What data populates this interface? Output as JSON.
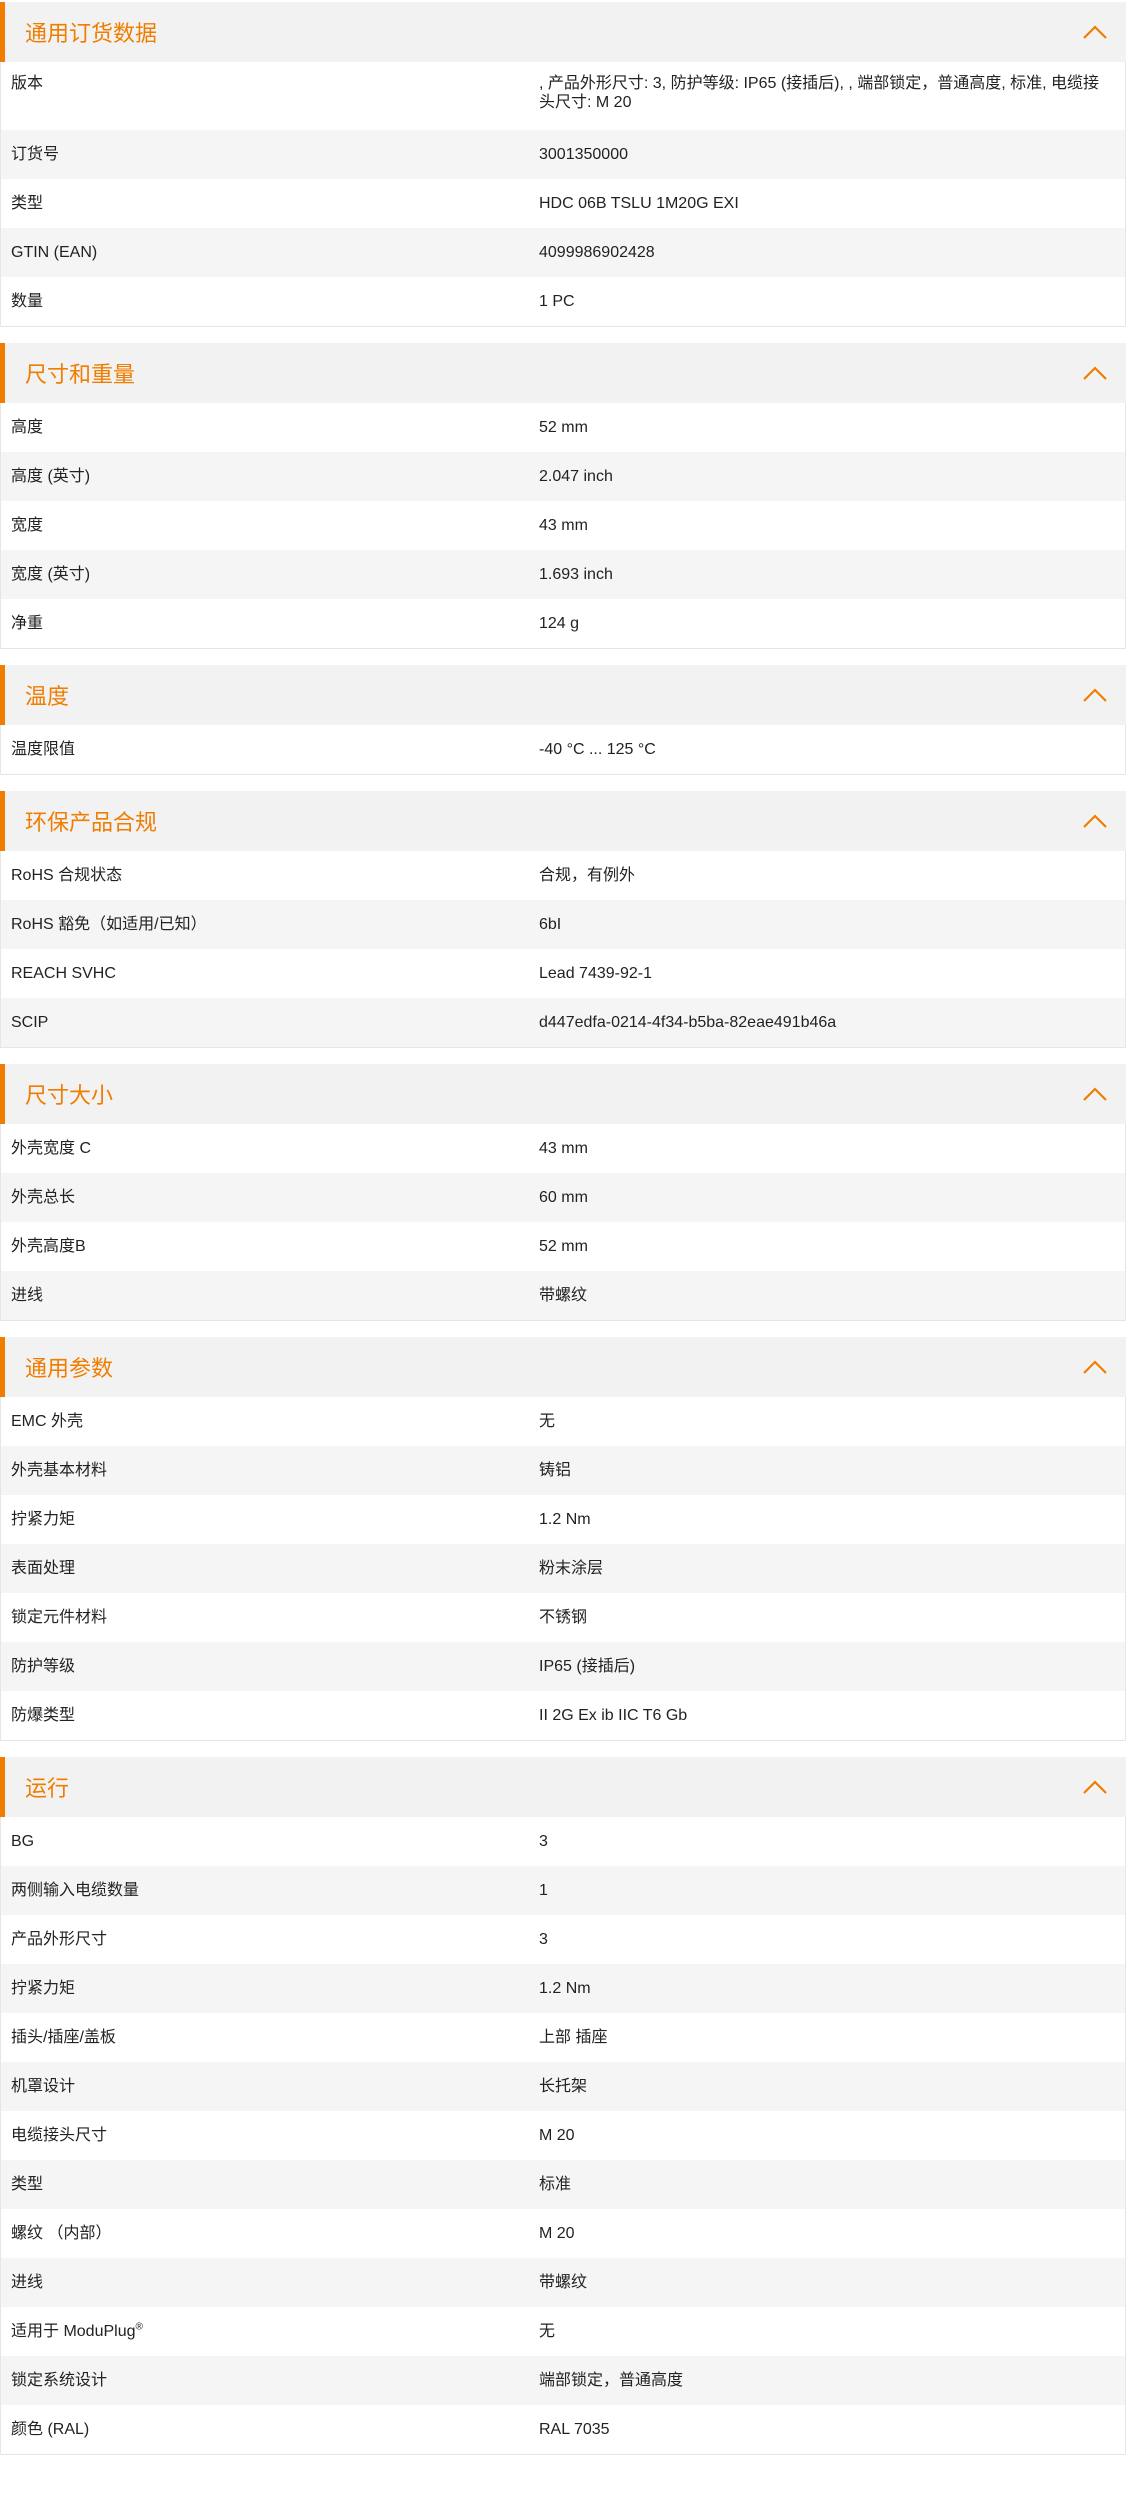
{
  "accent_color": "#f07d00",
  "toggle_icon": "chevron-up-icon",
  "sections": [
    {
      "title": "通用订货数据",
      "rows": [
        {
          "label": "版本",
          "value": ", 产品外形尺寸: 3, 防护等级: IP65 (接插后), , 端部锁定，普通高度, 标准, 电缆接头尺寸: M 20"
        },
        {
          "label": "订货号",
          "value": "3001350000"
        },
        {
          "label": "类型",
          "value": "HDC 06B TSLU 1M20G EXI"
        },
        {
          "label": "GTIN (EAN)",
          "value": "4099986902428"
        },
        {
          "label": "数量",
          "value": "1  PC"
        }
      ]
    },
    {
      "title": "尺寸和重量",
      "rows": [
        {
          "label": "高度",
          "value": "52  mm"
        },
        {
          "label": "高度 (英寸)",
          "value": "2.047  inch"
        },
        {
          "label": "宽度",
          "value": "43  mm"
        },
        {
          "label": "宽度 (英寸)",
          "value": "1.693  inch"
        },
        {
          "label": "净重",
          "value": "124  g"
        }
      ]
    },
    {
      "title": "温度",
      "rows": [
        {
          "label": "温度限值",
          "value": "-40 °C ... 125 °C"
        }
      ]
    },
    {
      "title": "环保产品合规",
      "rows": [
        {
          "label": "RoHS 合规状态",
          "value": "合规，有例外"
        },
        {
          "label": "RoHS 豁免（如适用/已知）",
          "value": "6bI"
        },
        {
          "label": "REACH SVHC",
          "value": "Lead 7439-92-1"
        },
        {
          "label": "SCIP",
          "value": "d447edfa-0214-4f34-b5ba-82eae491b46a"
        }
      ]
    },
    {
      "title": "尺寸大小",
      "rows": [
        {
          "label": "外壳宽度 C",
          "value": "43  mm"
        },
        {
          "label": "外壳总长",
          "value": "60  mm"
        },
        {
          "label": "外壳高度B",
          "value": "52  mm"
        },
        {
          "label": "进线",
          "value": "带螺纹"
        }
      ]
    },
    {
      "title": "通用参数",
      "rows": [
        {
          "label": "EMC 外壳",
          "value": "无"
        },
        {
          "label": "外壳基本材料",
          "value": "铸铝"
        },
        {
          "label": "拧紧力矩",
          "value": "1.2  Nm"
        },
        {
          "label": "表面处理",
          "value": "粉末涂层"
        },
        {
          "label": "锁定元件材料",
          "value": "不锈钢"
        },
        {
          "label": "防护等级",
          "value": "IP65 (接插后)"
        },
        {
          "label": "防爆类型",
          "value": "II 2G Ex ib IIC T6 Gb"
        }
      ]
    },
    {
      "title": "运行",
      "rows": [
        {
          "label": "BG",
          "value": "3"
        },
        {
          "label": "两侧输入电缆数量",
          "value": "1"
        },
        {
          "label": "产品外形尺寸",
          "value": "3"
        },
        {
          "label": "拧紧力矩",
          "value": "1.2  Nm"
        },
        {
          "label": "插头/插座/盖板",
          "value": "上部 插座"
        },
        {
          "label": "机罩设计",
          "value": "长托架"
        },
        {
          "label": "电缆接头尺寸",
          "value": "M 20"
        },
        {
          "label": "类型",
          "value": "标准"
        },
        {
          "label": "螺纹 （内部）",
          "value": "M 20"
        },
        {
          "label": "进线",
          "value": "带螺纹"
        },
        {
          "label": "适用于 ModuPlug",
          "label_sup": "®",
          "value": "无"
        },
        {
          "label": "锁定系统设计",
          "value": "端部锁定，普通高度"
        },
        {
          "label": "颜色 (RAL)",
          "value": "RAL 7035"
        }
      ]
    }
  ]
}
